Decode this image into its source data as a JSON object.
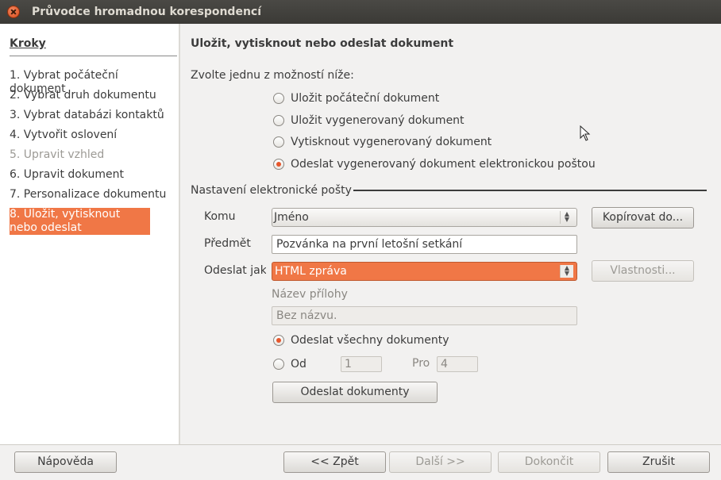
{
  "window": {
    "title": "Průvodce hromadnou korespondencí"
  },
  "sidebar": {
    "heading": "Kroky",
    "steps": [
      "1. Vybrat počáteční dokument",
      "2. Vybrat druh dokumentu",
      "3. Vybrat databázi kontaktů",
      "4. Vytvořit oslovení",
      "5. Upravit vzhled",
      "6. Upravit dokument",
      "7. Personalizace dokumentu",
      "8. Uložit, vytisknout nebo odeslat"
    ]
  },
  "main": {
    "heading": "Uložit, vytisknout nebo odeslat dokument",
    "prompt": "Zvolte jednu z možností níže:",
    "options": [
      "Uložit počáteční dokument",
      "Uložit vygenerovaný dokument",
      "Vytisknout vygenerovaný dokument",
      "Odeslat vygenerovaný dokument elektronickou poštou"
    ],
    "selected_option": 3,
    "email_section": {
      "title": "Nastavení elektronické pošty",
      "to_label": "Komu",
      "to_value": "Jméno",
      "copy_to_button": "Kopírovat do...",
      "subject_label": "Předmět",
      "subject_value": "Pozvánka na první letošní setkání",
      "send_as_label": "Odeslat jako",
      "send_as_value": "HTML zpráva",
      "properties_button": "Vlastnosti...",
      "attachment_label": "Název přílohy",
      "attachment_value": "Bez názvu.",
      "send_all_label": "Odeslat všechny dokumenty",
      "from_label": "Od",
      "from_value": "1",
      "to_range_label": "Pro",
      "to_range_value": "4",
      "send_button": "Odeslat dokumenty"
    }
  },
  "footer": {
    "help": "Nápověda",
    "back": "<< Zpět",
    "next": "Další >>",
    "finish": "Dokončit",
    "cancel": "Zrušit"
  },
  "colors": {
    "accent": "#f07746",
    "titlebar": "#3c3b37"
  }
}
